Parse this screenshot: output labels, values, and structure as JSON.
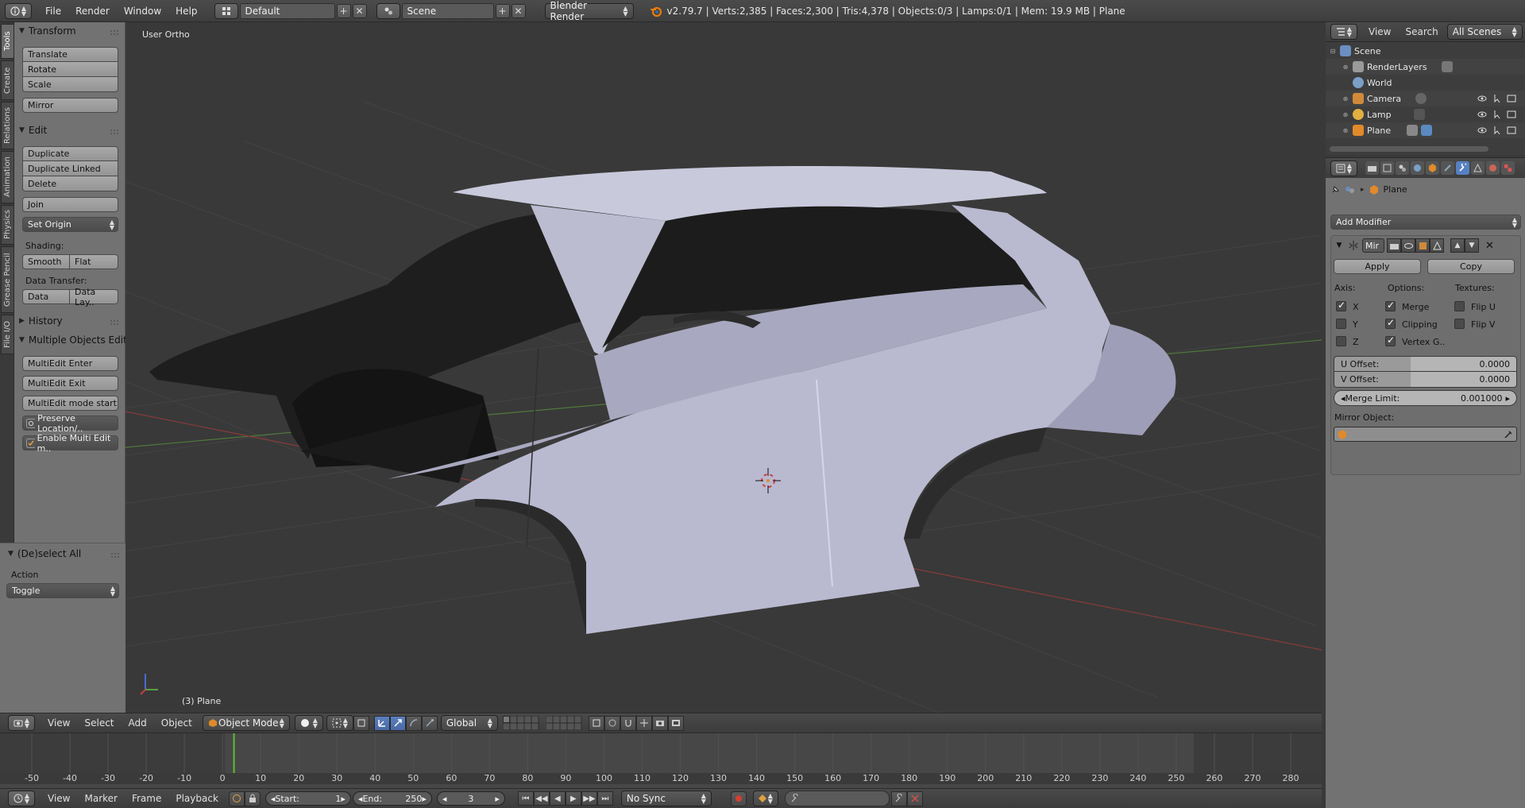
{
  "topbar": {
    "menus": [
      "File",
      "Render",
      "Window",
      "Help"
    ],
    "screen_layout": "Default",
    "scene": "Scene",
    "render_engine": "Blender Render",
    "stats": "v2.79.7 | Verts:2,385 | Faces:2,300 | Tris:4,378 | Objects:0/3 | Lamps:0/1 | Mem: 19.9 MB | Plane"
  },
  "vtabs": [
    "Tools",
    "Create",
    "Relations",
    "Animation",
    "Physics",
    "Grease Pencil",
    "File I/O"
  ],
  "toolshelf": {
    "transform": {
      "title": "Transform",
      "buttons": [
        "Translate",
        "Rotate",
        "Scale",
        "Mirror"
      ]
    },
    "edit": {
      "title": "Edit",
      "buttons": [
        "Duplicate",
        "Duplicate Linked",
        "Delete",
        "Join"
      ],
      "set_origin": "Set Origin",
      "shading_label": "Shading:",
      "smooth": "Smooth",
      "flat": "Flat",
      "data_transfer_label": "Data Transfer:",
      "data": "Data",
      "data_layout": "Data Lay.."
    },
    "history": {
      "title": "History"
    },
    "multi": {
      "title": "Multiple Objects Edit",
      "buttons": [
        "MultiEdit Enter",
        "MultiEdit Exit",
        "MultiEdit mode start",
        "Preserve Location/..",
        "Enable Multi Edit m.."
      ]
    }
  },
  "operator": {
    "title": "(De)select All",
    "action_label": "Action",
    "action_value": "Toggle"
  },
  "viewport": {
    "view_label": "User Ortho",
    "object_label": "(3) Plane"
  },
  "vp_header": {
    "menus": [
      "View",
      "Select",
      "Add",
      "Object"
    ],
    "mode": "Object Mode",
    "orientation": "Global"
  },
  "timeline": {
    "ticks": [
      "-50",
      "-40",
      "-30",
      "-20",
      "-10",
      "0",
      "10",
      "20",
      "30",
      "40",
      "50",
      "60",
      "70",
      "80",
      "90",
      "100",
      "110",
      "120",
      "130",
      "140",
      "150",
      "160",
      "170",
      "180",
      "190",
      "200",
      "210",
      "220",
      "230",
      "240",
      "250",
      "260",
      "270",
      "280"
    ],
    "current_frame": 3,
    "footer_menus": [
      "View",
      "Marker",
      "Frame",
      "Playback"
    ],
    "start_label": "Start:",
    "start": "1",
    "end_label": "End:",
    "end": "250",
    "frame": "3",
    "sync": "No Sync"
  },
  "outliner": {
    "menus": [
      "View",
      "Search"
    ],
    "filter": "All Scenes",
    "items": [
      {
        "label": "Scene",
        "icon": "scene-icon",
        "color": "#6a8fc0"
      },
      {
        "label": "RenderLayers",
        "icon": "render-layers-icon",
        "color": "#9a9a9a"
      },
      {
        "label": "World",
        "icon": "world-icon",
        "color": "#7aa0c8"
      },
      {
        "label": "Camera",
        "icon": "camera-icon",
        "color": "#d08a3a"
      },
      {
        "label": "Lamp",
        "icon": "lamp-icon",
        "color": "#e0b040"
      },
      {
        "label": "Plane",
        "icon": "mesh-icon",
        "color": "#e08a2a"
      }
    ]
  },
  "properties": {
    "object_name": "Plane",
    "add_modifier": "Add Modifier",
    "modifier_short": "Mir",
    "apply": "Apply",
    "copy": "Copy",
    "axis_label": "Axis:",
    "options_label": "Options:",
    "textures_label": "Textures:",
    "axes": [
      {
        "label": "X",
        "on": true
      },
      {
        "label": "Y",
        "on": false
      },
      {
        "label": "Z",
        "on": false
      }
    ],
    "options": [
      {
        "label": "Merge",
        "on": true
      },
      {
        "label": "Clipping",
        "on": true
      },
      {
        "label": "Vertex G..",
        "on": true
      }
    ],
    "textures": [
      {
        "label": "Flip U",
        "on": false
      },
      {
        "label": "Flip V",
        "on": false
      }
    ],
    "u_offset_label": "U Offset:",
    "u_offset": "0.0000",
    "v_offset_label": "V Offset:",
    "v_offset": "0.0000",
    "merge_limit_label": "Merge Limit:",
    "merge_limit": "0.001000",
    "mirror_object_label": "Mirror Object:"
  },
  "colors": {
    "accent": "#5680c2",
    "body": "#b8b8d0",
    "grid": "#434343"
  }
}
